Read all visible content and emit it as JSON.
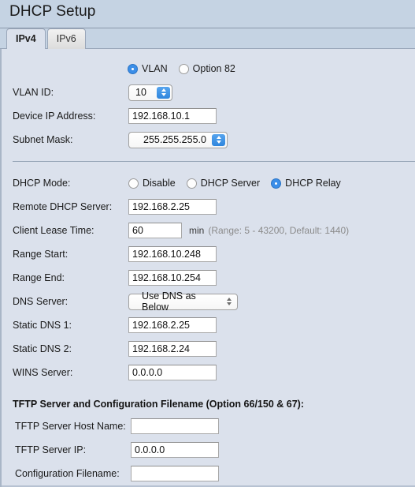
{
  "header": {
    "title": "DHCP Setup"
  },
  "tabs": [
    {
      "label": "IPv4",
      "active": true
    },
    {
      "label": "IPv6",
      "active": false
    }
  ],
  "form": {
    "mode_selector": {
      "options": [
        {
          "label": "VLAN",
          "selected": true
        },
        {
          "label": "Option 82",
          "selected": false
        }
      ]
    },
    "vlan_id": {
      "label": "VLAN ID:",
      "value": "10"
    },
    "device_ip": {
      "label": "Device IP Address:",
      "value": "192.168.10.1"
    },
    "subnet_mask": {
      "label": "Subnet Mask:",
      "value": "255.255.255.0"
    },
    "dhcp_mode": {
      "label": "DHCP Mode:",
      "options": [
        {
          "label": "Disable",
          "selected": false
        },
        {
          "label": "DHCP Server",
          "selected": false
        },
        {
          "label": "DHCP Relay",
          "selected": true
        }
      ]
    },
    "remote_dhcp_server": {
      "label": "Remote DHCP Server:",
      "value": "192.168.2.25"
    },
    "client_lease_time": {
      "label": "Client Lease Time:",
      "value": "60",
      "unit": "min",
      "hint": "(Range: 5 - 43200, Default: 1440)"
    },
    "range_start": {
      "label": "Range Start:",
      "value": "192.168.10.248"
    },
    "range_end": {
      "label": "Range End:",
      "value": "192.168.10.254"
    },
    "dns_server": {
      "label": "DNS Server:",
      "value": "Use DNS as Below"
    },
    "static_dns_1": {
      "label": "Static DNS 1:",
      "value": "192.168.2.25"
    },
    "static_dns_2": {
      "label": "Static DNS 2:",
      "value": "192.168.2.24"
    },
    "wins_server": {
      "label": "WINS Server:",
      "value": "0.0.0.0"
    },
    "tftp_section": {
      "title": "TFTP Server and Configuration Filename (Option 66/150 & 67):",
      "host_name": {
        "label": "TFTP Server Host Name:",
        "value": ""
      },
      "server_ip": {
        "label": "TFTP Server IP:",
        "value": "0.0.0.0"
      },
      "config_filename": {
        "label": "Configuration Filename:",
        "value": ""
      }
    }
  },
  "colors": {
    "header_bg": "#c5d3e3",
    "panel_bg": "#dbe1ec",
    "accent_blue": "#3b8ee8",
    "divider": "#94a3b5",
    "hint_text": "#8b8b8b"
  }
}
